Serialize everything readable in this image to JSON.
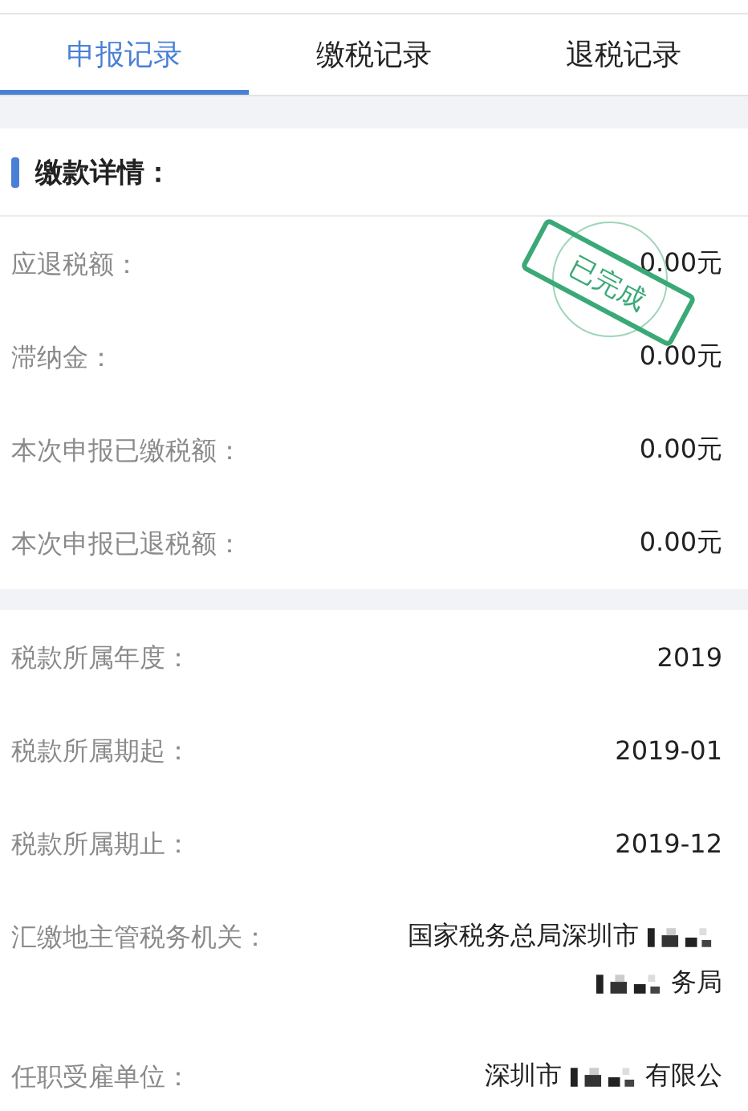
{
  "tabs": [
    {
      "label": "申报记录",
      "selected": true
    },
    {
      "label": "缴税记录",
      "selected": false
    },
    {
      "label": "退税记录",
      "selected": false
    }
  ],
  "payment_section": {
    "title": "缴款详情：",
    "stamp": {
      "text": "已完成"
    },
    "rows": [
      {
        "label": "应退税额：",
        "value": [
          {
            "kind": "text",
            "text": "0.00元"
          }
        ]
      },
      {
        "label": "滞纳金：",
        "value": [
          {
            "kind": "text",
            "text": "0.00元"
          }
        ]
      },
      {
        "label": "本次申报已缴税额：",
        "value": [
          {
            "kind": "text",
            "text": "0.00元"
          }
        ]
      },
      {
        "label": "本次申报已退税额：",
        "value": [
          {
            "kind": "text",
            "text": "0.00元"
          }
        ]
      }
    ]
  },
  "tax_section": {
    "rows": [
      {
        "label": "税款所属年度：",
        "value": [
          {
            "kind": "text",
            "text": "2019"
          }
        ]
      },
      {
        "label": "税款所属期起：",
        "value": [
          {
            "kind": "text",
            "text": "2019-01"
          }
        ]
      },
      {
        "label": "税款所属期止：",
        "value": [
          {
            "kind": "text",
            "text": "2019-12"
          }
        ]
      },
      {
        "label": "汇缴地主管税务机关：",
        "value": [
          {
            "kind": "text",
            "text": "国家税务总局深圳市"
          },
          {
            "kind": "redacted"
          },
          {
            "kind": "break"
          },
          {
            "kind": "redacted"
          },
          {
            "kind": "text",
            "text": "务局"
          }
        ]
      },
      {
        "label": "任职受雇单位：",
        "value": [
          {
            "kind": "text",
            "text": "深圳市"
          },
          {
            "kind": "redacted"
          },
          {
            "kind": "text",
            "text": "有限公"
          }
        ]
      }
    ]
  }
}
